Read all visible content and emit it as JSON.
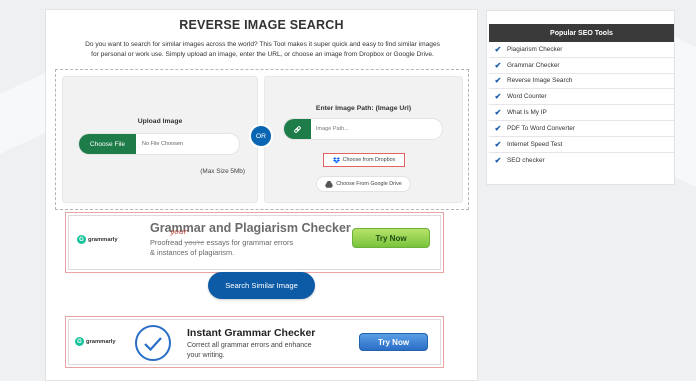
{
  "page": {
    "title": "REVERSE IMAGE SEARCH",
    "intro_line1": "Do you want to search for similar images across the world? This Tool makes it super quick and easy to find similar images",
    "intro_line2": "for personal or work use. Simply upload an image, enter the URL, or choose an image from Dropbox or Google Drive."
  },
  "upload": {
    "label": "Upload Image",
    "choose_file_label": "Choose File",
    "file_status": "No File Choosen",
    "max_size": "(Max Size 5Mb)",
    "or_label": "OR"
  },
  "url": {
    "label": "Enter Image Path: (Image Url)",
    "placeholder": "Image Path...",
    "value": ""
  },
  "sources": {
    "dropbox_label": "Choose from Dropbox",
    "gdrive_label": "Choose From Google Drive"
  },
  "ad_grammarly": {
    "logo_text": "grammarly",
    "title": "Grammar and Plagiarism Checker",
    "body_prefix": "Proofread",
    "body_strike": "you're",
    "body_rest": "essays for grammar errors",
    "body_line2": "& instances of plagiarism.",
    "handwritten": "your",
    "button": "Try Now"
  },
  "search_button": "Search Similar Image",
  "ad_instant": {
    "logo_text": "grammarly",
    "title": "Instant Grammar Checker",
    "body_line1": "Correct all grammar errors and enhance",
    "body_line2": "your writing.",
    "button": "Try Now"
  },
  "sidebar": {
    "title": "Popular SEO Tools",
    "items": [
      "Plagiarism Checker",
      "Grammar Checker",
      "Reverse Image Search",
      "Word Counter",
      "What Is My IP",
      "PDF To Word Converter",
      "Internet Speed Test",
      "SEO checker"
    ]
  },
  "colors": {
    "green_accent": "#1e7c48",
    "blue_accent": "#0d5ba6",
    "sidebar_header": "#3a3a3a"
  }
}
